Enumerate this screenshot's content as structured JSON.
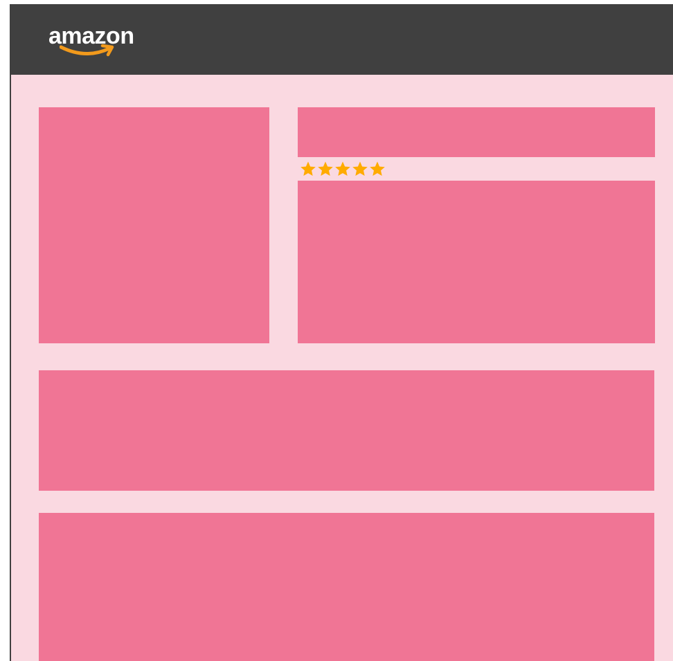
{
  "header": {
    "logo_text": "amazon",
    "logo_icon": "amazon-smile-icon",
    "background_color": "#404040",
    "smile_color": "#f29a1c"
  },
  "product": {
    "rating": {
      "stars_filled": 5,
      "stars_total": 5,
      "star_color": "#ffab00",
      "icon": "star-icon"
    }
  },
  "colors": {
    "page_background": "#fad9e1",
    "placeholder": "#f07595"
  }
}
